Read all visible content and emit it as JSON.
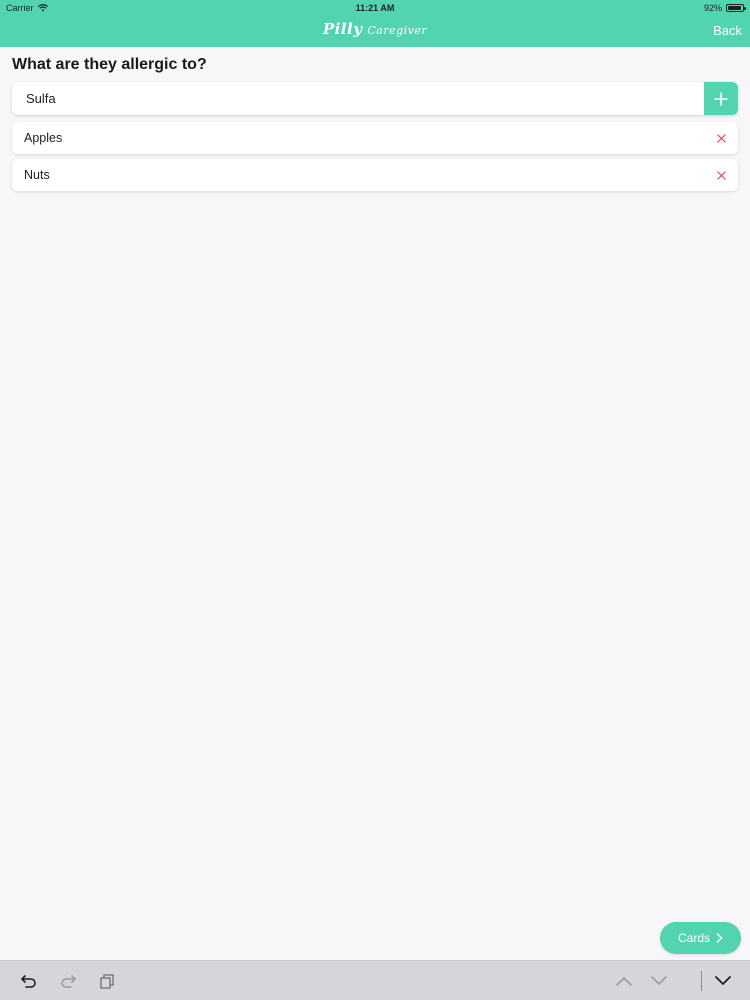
{
  "status_bar": {
    "carrier": "Carrier",
    "time": "11:21 AM",
    "battery": "92%",
    "battery_level": 0.92
  },
  "nav": {
    "brand": "Pilly",
    "subtitle": "Caregiver",
    "back_label": "Back"
  },
  "main": {
    "question": "What are they allergic to?",
    "input": {
      "value": "Sulfa",
      "placeholder": ""
    },
    "allergies": [
      {
        "label": "Apples"
      },
      {
        "label": "Nuts"
      }
    ],
    "cards_label": "Cards"
  },
  "colors": {
    "accent": "#52d4b1",
    "remove": "#e0505a",
    "background": "#f7f7f9"
  },
  "icons": {
    "add": "plus-icon",
    "remove": "close-icon",
    "cards": "chevron-right-icon",
    "bottom_bar": [
      "undo-icon",
      "redo-icon",
      "clipboard-icon",
      "chevron-up-icon",
      "chevron-down-icon",
      "keyboard-dismiss-icon"
    ]
  }
}
